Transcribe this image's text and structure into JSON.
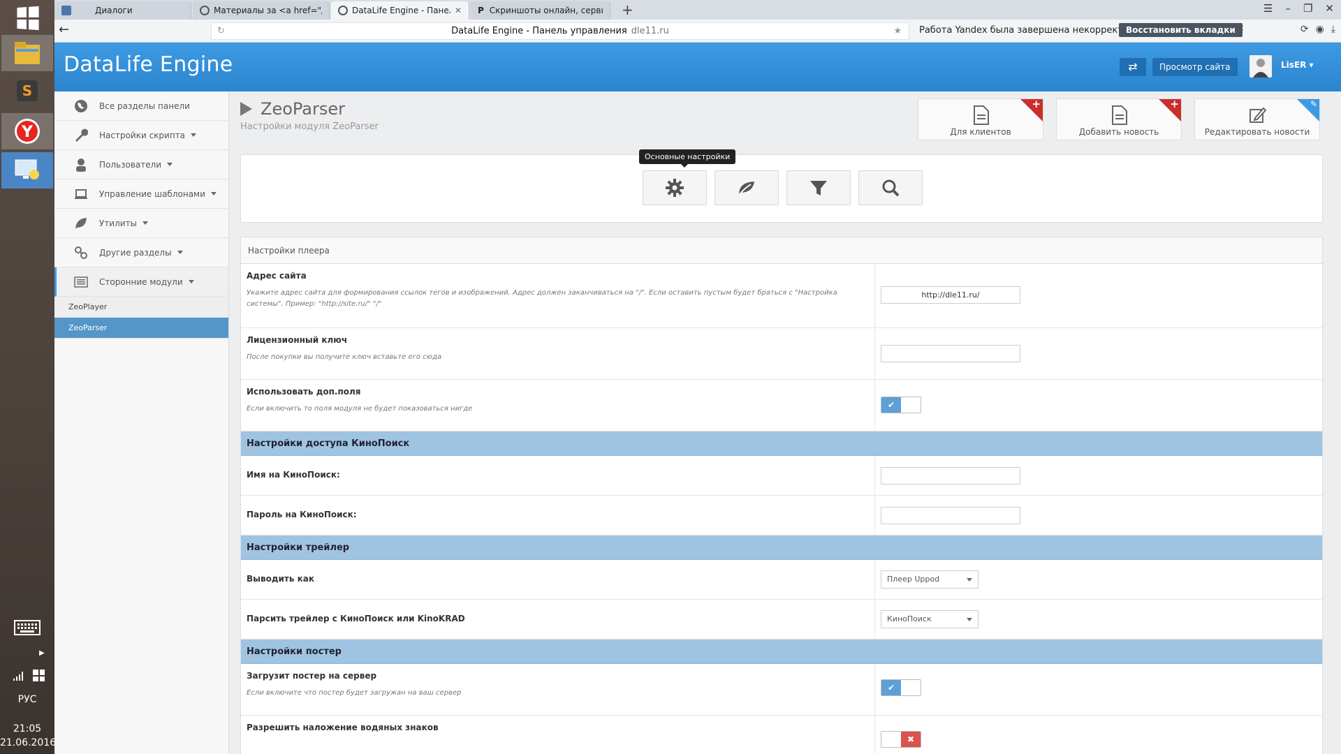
{
  "taskbar": {
    "lang": "РУС",
    "time": "21:05",
    "date": "21.06.2016"
  },
  "browser": {
    "tabs": [
      {
        "label": "Диалоги"
      },
      {
        "label": "Материалы за <a href=\"/inde"
      },
      {
        "label": "DataLife Engine - Панель уп"
      },
      {
        "label": "Скриншоты онлайн, сервис пс"
      }
    ],
    "url_title": "DataLife Engine - Панель управления",
    "url_domain": "dle11.ru",
    "crash_text": "Работа Yandex была завершена некорректно.",
    "restore_label": "Восстановить вкладки"
  },
  "header": {
    "logo": "DataLife Engine",
    "view_site": "Просмотр сайта",
    "user": "LisER"
  },
  "sidebar": {
    "items": [
      {
        "label": "Все разделы панели"
      },
      {
        "label": "Настройки скрипта"
      },
      {
        "label": "Пользователи"
      },
      {
        "label": "Управление шаблонами"
      },
      {
        "label": "Утилиты"
      },
      {
        "label": "Другие разделы"
      },
      {
        "label": "Сторонние модули"
      }
    ],
    "sub": [
      {
        "label": "ZeoPlayer"
      },
      {
        "label": "ZeoParser"
      }
    ]
  },
  "page": {
    "title": "ZeoParser",
    "subtitle": "Настройки модуля ZeoParser",
    "quick": [
      {
        "label": "Для клиентов"
      },
      {
        "label": "Добавить новость"
      },
      {
        "label": "Редактировать новости"
      }
    ],
    "tooltip": "Основные настройки"
  },
  "settings": {
    "header": "Настройки плеера",
    "site": {
      "title": "Адрес сайта",
      "desc": "Укажите адрес сайта для формирования ссылок тегов и изображений. Адрес должен заканчиваться на \"/\". Если оставить пустым будет браться с \"Настройка системы\". Пример: \"http://site.ru/\" \"/\"",
      "value": "http://dle11.ru/"
    },
    "license": {
      "title": "Лицензионный ключ",
      "desc": "После покупки вы получите ключ вставьте его сюда"
    },
    "extra_fields": {
      "title": "Использовать доп.поля",
      "desc": "Если включить то поля модуля не будет показоваться нигде"
    },
    "kp_section": "Настройки доступа КиноПоиск",
    "kp_name": "Имя на КиноПоиск:",
    "kp_pass": "Пароль на КиноПоиск:",
    "trailer_section": "Настройки трейлер",
    "output_as": {
      "title": "Выводить как",
      "value": "Плеер Uppod"
    },
    "parse_trailer": {
      "title": "Парсить трейлер с КиноПоиск или KinoKRAD",
      "value": "КиноПоиск"
    },
    "poster_section": "Настройки постер",
    "upload_poster": {
      "title": "Загрузит постер на сервер",
      "desc": "Если включите что постер будет загружан на ваш сервер"
    },
    "watermark": {
      "title": "Разрешить наложение водяных знаков"
    }
  }
}
